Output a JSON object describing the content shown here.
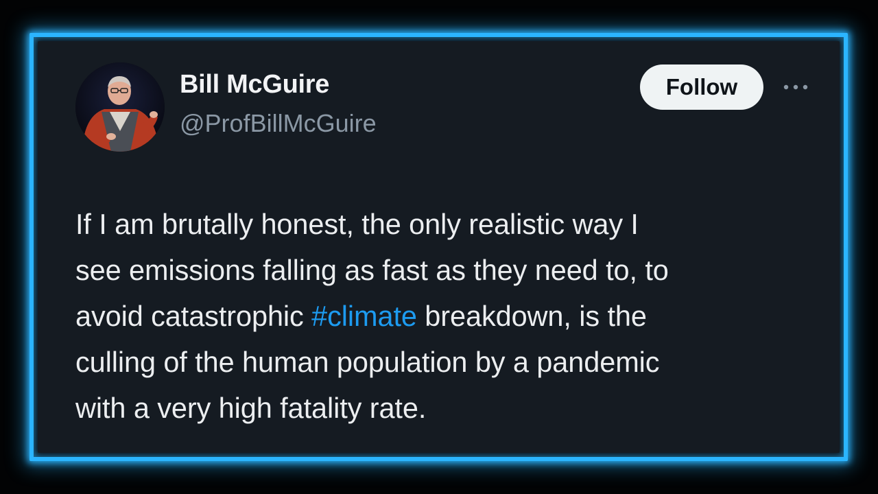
{
  "author": {
    "display_name": "Bill McGuire",
    "handle": "@ProfBillMcGuire",
    "avatar_icon": "profile-photo"
  },
  "actions": {
    "follow_label": "Follow",
    "more_icon": "more-horizontal-icon"
  },
  "tweet": {
    "line_1": "If I am brutally honest, the only realistic way I",
    "line_2": "see emissions falling as fast as they need to, to",
    "line_3_before": "avoid catastrophic ",
    "hashtag": "#climate",
    "line_3_after": " breakdown, is the",
    "line_4": "culling of the human population by a pandemic",
    "line_5": "with a very high fatality rate."
  },
  "colors": {
    "frame_glow": "#2bb5ff",
    "card_background": "#151b22",
    "hashtag": "#1d9bf0",
    "handle": "#8b98a5",
    "follow_button": "#eff3f4"
  }
}
